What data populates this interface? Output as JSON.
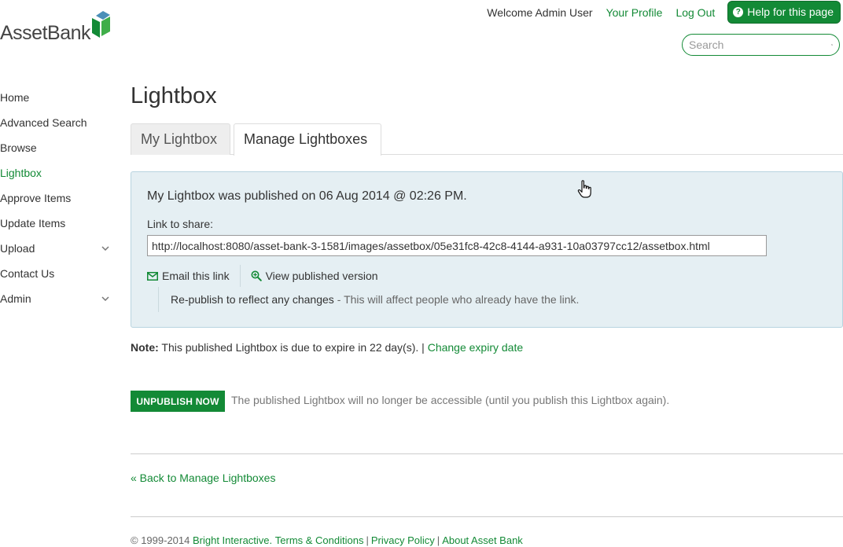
{
  "brand": {
    "logo_text": "AssetBank",
    "accent": "#138a36"
  },
  "header": {
    "welcome": "Welcome Admin User",
    "your_profile": "Your Profile",
    "log_out": "Log Out",
    "help": "Help for this page",
    "search_placeholder": "Search"
  },
  "sidebar": {
    "items": [
      {
        "label": "Home",
        "active": false,
        "has_submenu": false
      },
      {
        "label": "Advanced Search",
        "active": false,
        "has_submenu": false
      },
      {
        "label": "Browse",
        "active": false,
        "has_submenu": false
      },
      {
        "label": "Lightbox",
        "active": true,
        "has_submenu": false
      },
      {
        "label": "Approve Items",
        "active": false,
        "has_submenu": false
      },
      {
        "label": "Update Items",
        "active": false,
        "has_submenu": false
      },
      {
        "label": "Upload",
        "active": false,
        "has_submenu": true
      },
      {
        "label": "Contact Us",
        "active": false,
        "has_submenu": false
      },
      {
        "label": "Admin",
        "active": false,
        "has_submenu": true
      }
    ]
  },
  "main": {
    "title": "Lightbox",
    "tabs": [
      {
        "label": "My Lightbox",
        "selected": false
      },
      {
        "label": "Manage Lightboxes",
        "selected": true
      }
    ],
    "panel": {
      "heading": "My Lightbox was published on 06 Aug 2014 @ 02:26 PM.",
      "share_label": "Link to share:",
      "share_url": "http://localhost:8080/asset-bank-3-1581/images/assetbox/05e31fc8-42c8-4144-a931-10a03797cc12/assetbox.html",
      "email_link": "Email this link",
      "view_published": "View published version",
      "republish_link": "Re-publish to reflect any changes",
      "republish_desc": "- This will affect people who already have the link."
    },
    "note": {
      "label": "Note:",
      "text": "This published Lightbox is due to expire in 22 day(s). |",
      "change_expiry": "Change expiry date"
    },
    "unpublish": {
      "button": "UNPUBLISH NOW",
      "description": "The published Lightbox will no longer be accessible (until you publish this Lightbox again)."
    },
    "back_link": "« Back to Manage Lightboxes"
  },
  "footer": {
    "copyright": "© 1999-2014",
    "company": "Bright Interactive.",
    "terms": "Terms & Conditions",
    "privacy": "Privacy Policy",
    "about": "About Asset Bank",
    "separator": "|"
  },
  "icons": {
    "logo_mark": "cube-icon",
    "help": "question-circle-icon",
    "search": "search-icon",
    "submenu": "chevron-down-icon",
    "email": "envelope-icon",
    "view": "zoom-icon",
    "cursor": "hand-pointer-icon"
  }
}
